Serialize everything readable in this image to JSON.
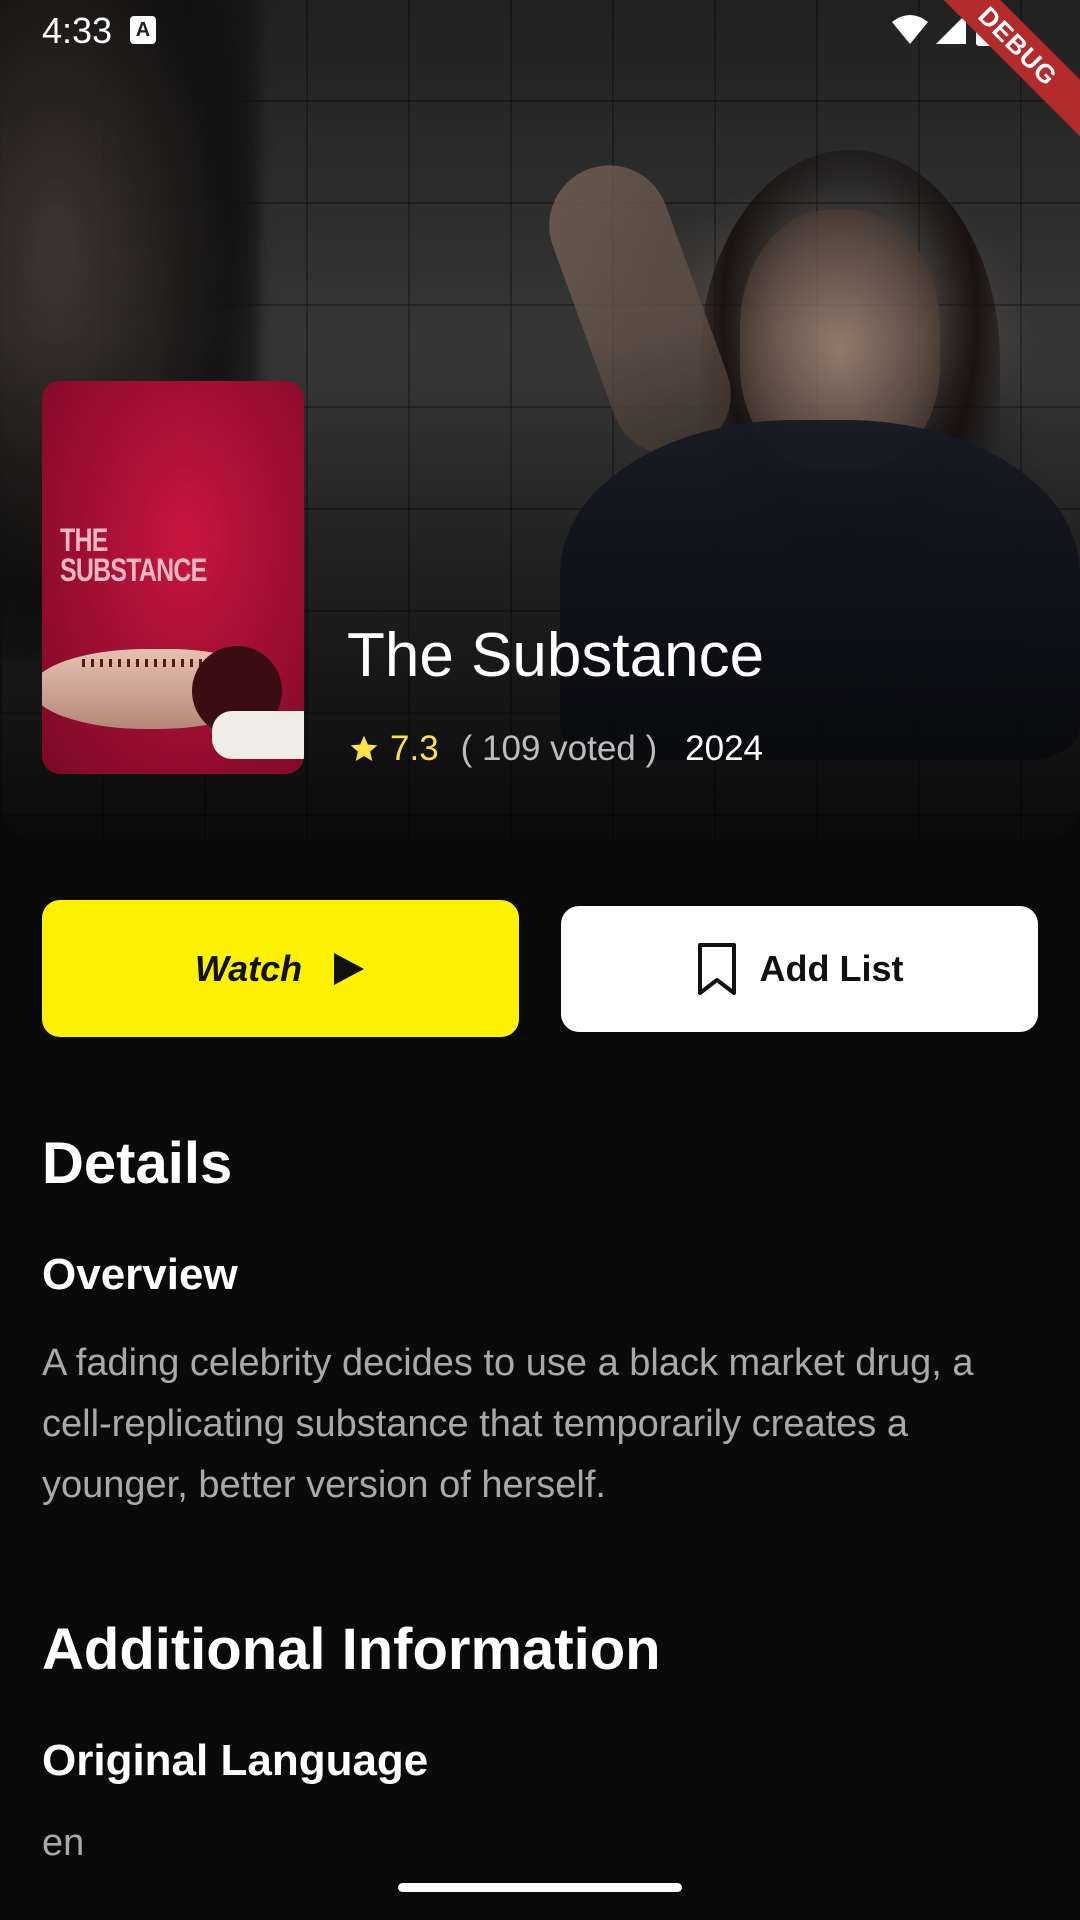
{
  "status_bar": {
    "time": "4:33",
    "notification_icon": "A",
    "icons": [
      "wifi-icon",
      "signal-icon",
      "battery-icon"
    ],
    "debug_banner": "DEBUG"
  },
  "movie": {
    "title": "The Substance",
    "rating": "7.3",
    "votes": "( 109 voted )",
    "year": "2024",
    "poster_text_line1": "THE",
    "poster_text_line2": "SUBSTANCE"
  },
  "actions": {
    "watch_label": "Watch",
    "add_list_label": "Add List"
  },
  "details": {
    "heading": "Details",
    "overview_heading": "Overview",
    "overview_text": "A fading celebrity decides to use a black market drug, a cell-replicating substance that temporarily creates a younger, better version of herself."
  },
  "additional": {
    "heading": "Additional Information",
    "language_heading": "Original Language",
    "language_value": "en"
  },
  "colors": {
    "accent": "#fff200",
    "rating": "#ffe04a",
    "background": "#0a0a0a",
    "debug": "#b52a2a"
  }
}
